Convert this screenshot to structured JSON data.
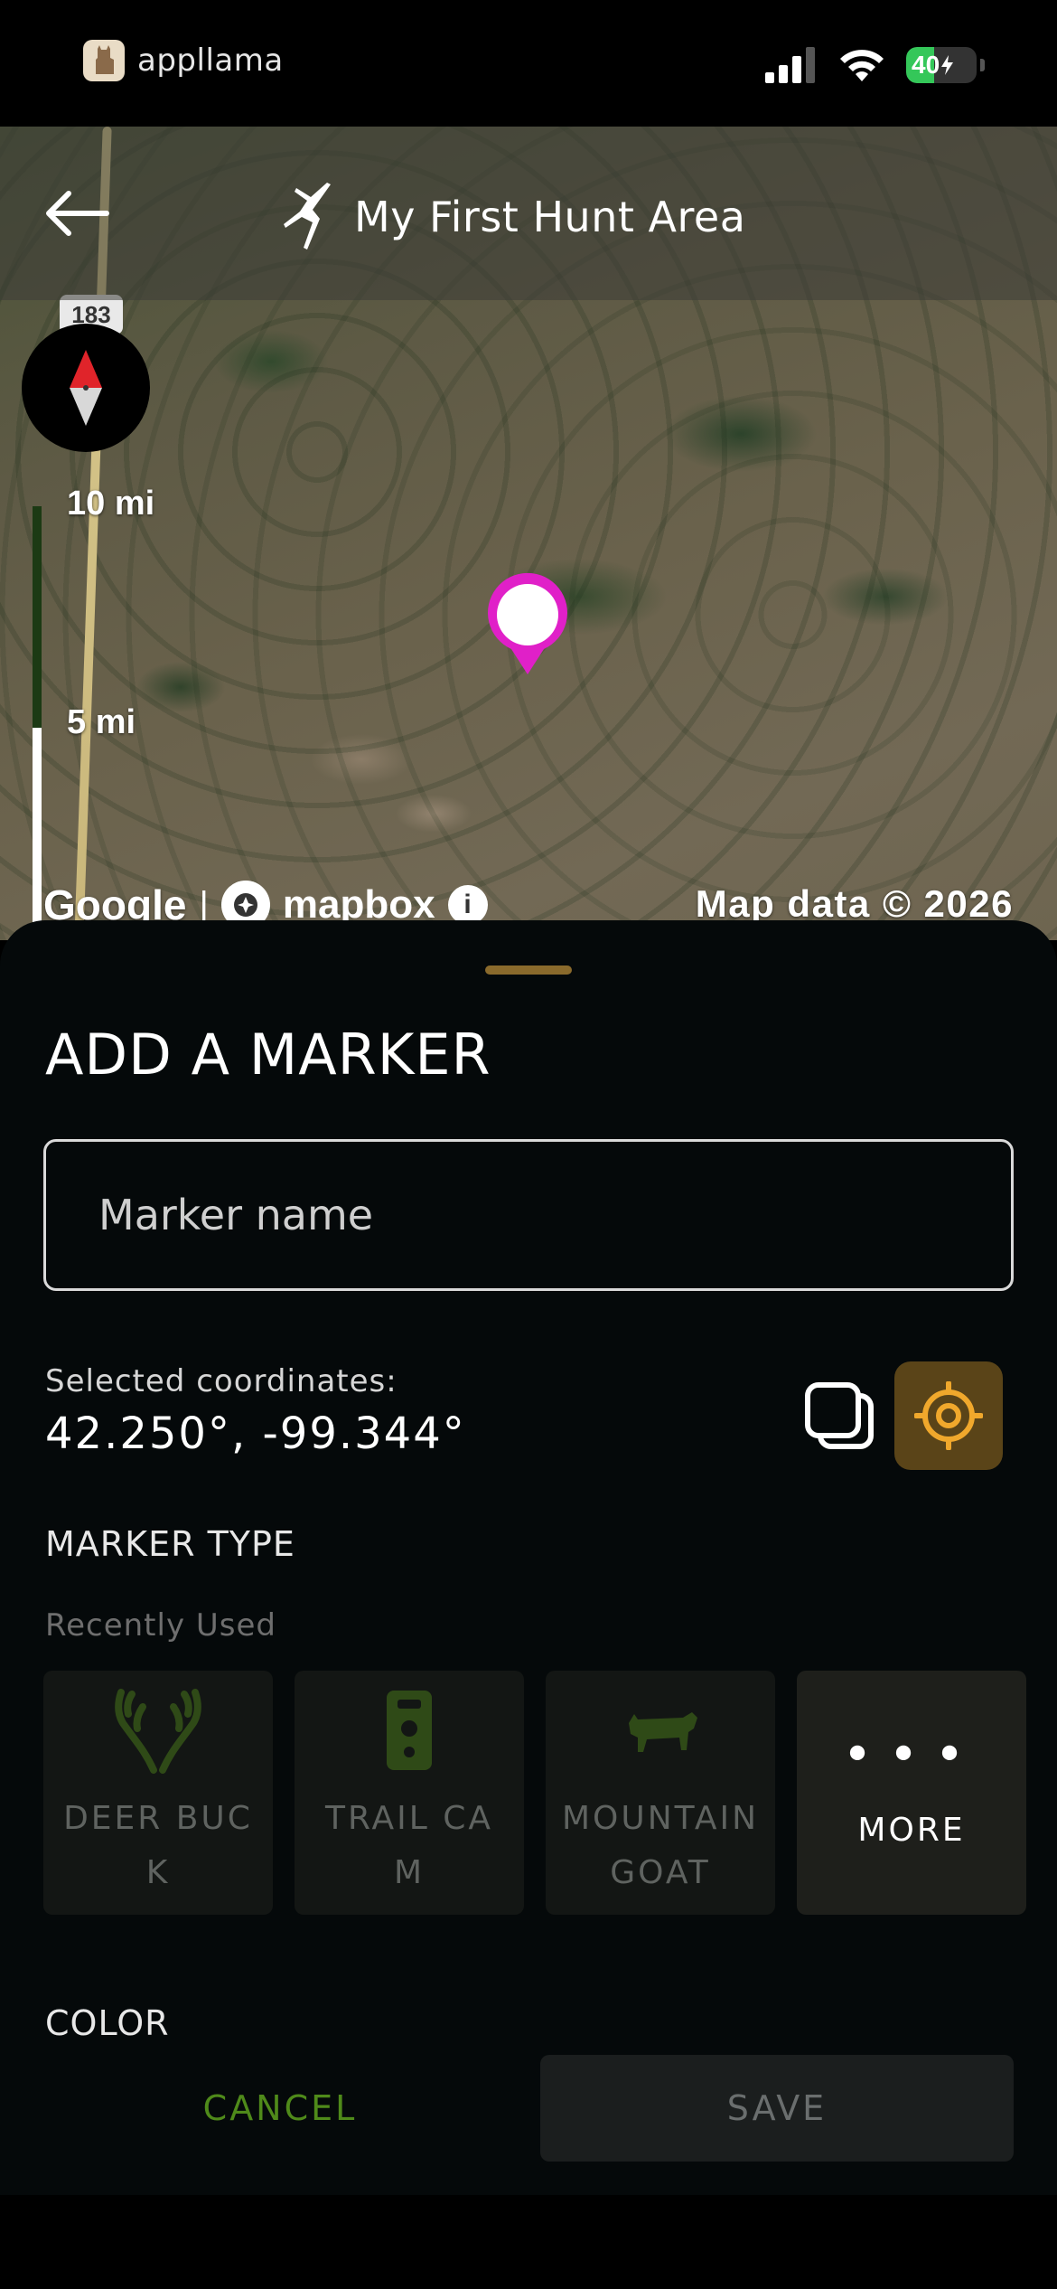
{
  "status_bar": {
    "carrier": "appllama",
    "battery": "40",
    "battery_level_percent": 40
  },
  "header": {
    "title": "My First Hunt Area"
  },
  "map": {
    "highway_number": "183",
    "scale_labels": [
      "10 mi",
      "5 mi"
    ],
    "attribution_google": "Google",
    "attribution_separator": "|",
    "attribution_mapbox": "mapbox",
    "info_glyph": "i",
    "map_data": "Map data © 2026",
    "pin_color": "#e020c8"
  },
  "sheet": {
    "title": "ADD A MARKER",
    "name_placeholder": "Marker name",
    "name_value": "",
    "coords_label": "Selected coordinates:",
    "coords_value": "42.250°, -99.344°",
    "marker_type_label": "MARKER TYPE",
    "recently_used_label": "Recently Used",
    "types": [
      {
        "label": "DEER BUCK",
        "icon": "antlers-icon"
      },
      {
        "label": "TRAIL CAM",
        "icon": "trail-camera-icon"
      },
      {
        "label": "MOUNTAIN GOAT",
        "icon": "mountain-goat-icon"
      },
      {
        "label": "MORE",
        "icon": "more-dots-icon"
      }
    ],
    "more_dots": "•••",
    "color_label": "COLOR",
    "cancel_label": "CANCEL",
    "save_label": "SAVE"
  },
  "colors": {
    "accent_gold": "#e2a12c",
    "cancel_green": "#4f8a1a",
    "sheet_bg": "#05090a"
  }
}
